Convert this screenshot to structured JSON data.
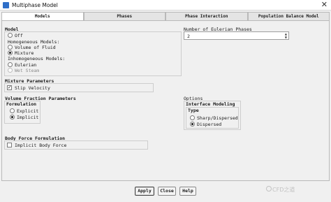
{
  "window": {
    "title": "Multiphase Model",
    "close_glyph": "✕"
  },
  "tabs": [
    {
      "label": "Models",
      "active": true
    },
    {
      "label": "Phases",
      "active": false
    },
    {
      "label": "Phase Interaction",
      "active": false
    },
    {
      "label": "Population Balance Model",
      "active": false
    }
  ],
  "model": {
    "heading": "Model",
    "off_label": "Off",
    "homogeneous_heading": "Homogeneous Models:",
    "vof_label": "Volume of Fluid",
    "mixture_label": "Mixture",
    "inhomogeneous_heading": "Inhomogeneous Models:",
    "eulerian_label": "Eulerian",
    "wet_steam_label": "Wet Steam",
    "selected": "Mixture"
  },
  "eulerian_phases": {
    "label": "Number of Eulerian Phases",
    "value": "2"
  },
  "mixture_parameters": {
    "heading": "Mixture Parameters",
    "slip_velocity_label": "Slip Velocity",
    "slip_velocity_checked": true
  },
  "volume_fraction": {
    "heading": "Volume Fraction Parameters",
    "formulation_heading": "Formulation",
    "explicit_label": "Explicit",
    "implicit_label": "Implicit",
    "selected": "Implicit"
  },
  "options": {
    "heading": "Options",
    "interface_modeling_heading": "Interface Modeling",
    "type_heading": "Type",
    "sharp_dispersed_label": "Sharp/Dispersed",
    "dispersed_label": "Dispersed",
    "selected": "Dispersed"
  },
  "body_force": {
    "heading": "Body Force Formulation",
    "implicit_body_force_label": "Implicit Body Force",
    "checked": false
  },
  "buttons": {
    "apply": "Apply",
    "close": "Close",
    "help": "Help"
  },
  "watermark": {
    "text": "CFD之道"
  }
}
